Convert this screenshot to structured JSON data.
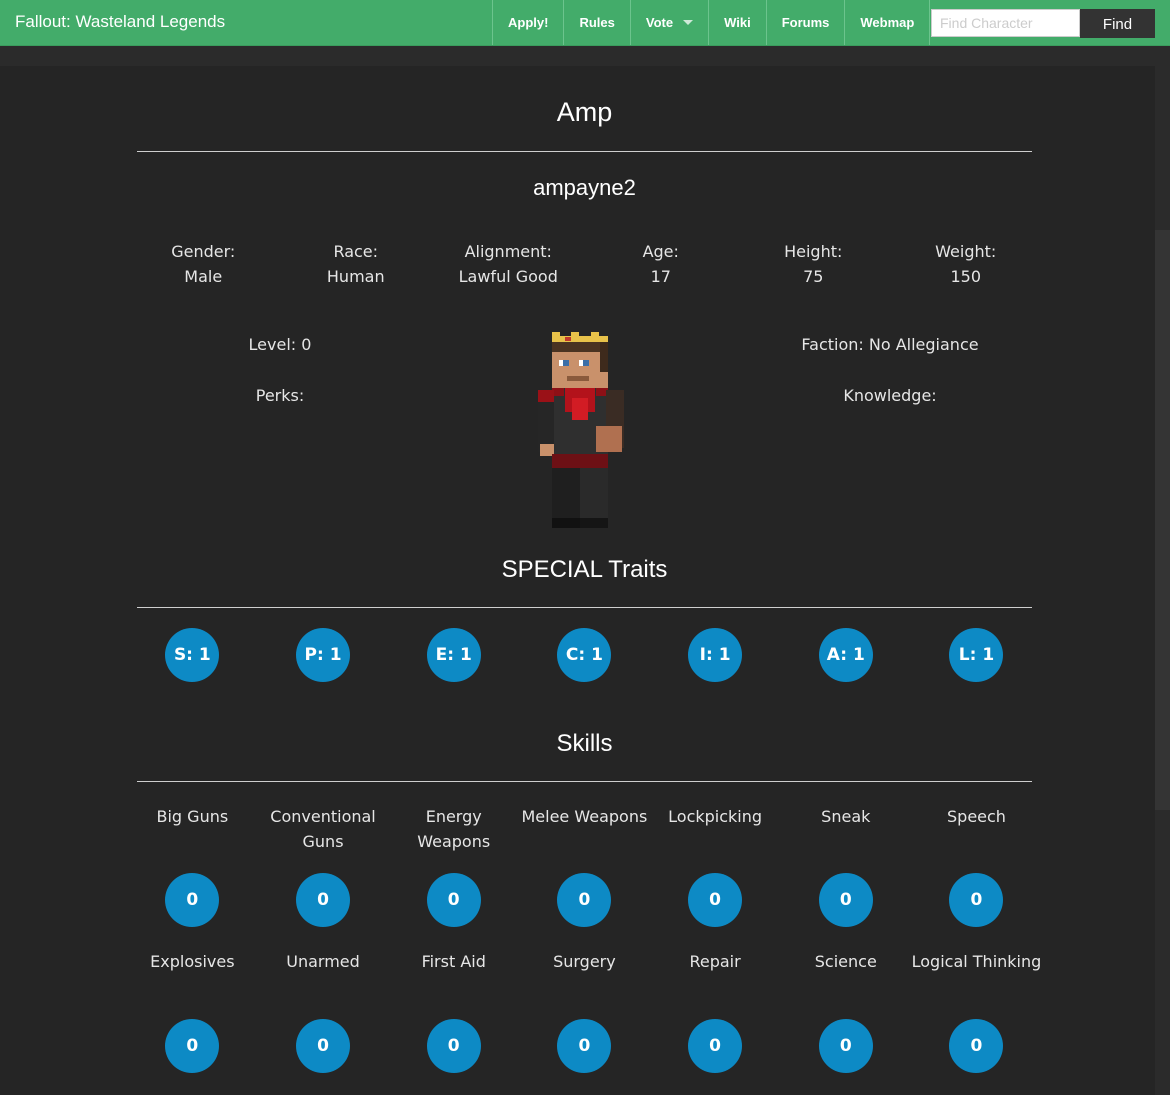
{
  "navbar": {
    "brand": "Fallout: Wasteland Legends",
    "items": [
      "Apply!",
      "Rules",
      "Vote",
      "Wiki",
      "Forums",
      "Webmap"
    ],
    "search_placeholder": "Find Character",
    "find_label": "Find"
  },
  "character": {
    "name": "Amp",
    "username": "ampayne2",
    "info": [
      {
        "label": "Gender:",
        "value": "Male"
      },
      {
        "label": "Race:",
        "value": "Human"
      },
      {
        "label": "Alignment:",
        "value": "Lawful Good"
      },
      {
        "label": "Age:",
        "value": "17"
      },
      {
        "label": "Height:",
        "value": "75"
      },
      {
        "label": "Weight:",
        "value": "150"
      }
    ],
    "level": "Level: 0",
    "perks": "Perks:",
    "faction": "Faction: No Allegiance",
    "knowledge": "Knowledge:"
  },
  "special": {
    "title": "SPECIAL Traits",
    "traits": [
      "S: 1",
      "P: 1",
      "E: 1",
      "C: 1",
      "I: 1",
      "A: 1",
      "L: 1"
    ]
  },
  "skills": {
    "title": "Skills",
    "row1": [
      {
        "name": "Big Guns",
        "value": "0"
      },
      {
        "name": "Conventional Guns",
        "value": "0"
      },
      {
        "name": "Energy Weapons",
        "value": "0"
      },
      {
        "name": "Melee Weapons",
        "value": "0"
      },
      {
        "name": "Lockpicking",
        "value": "0"
      },
      {
        "name": "Sneak",
        "value": "0"
      },
      {
        "name": "Speech",
        "value": "0"
      }
    ],
    "row2": [
      {
        "name": "Explosives",
        "value": "0"
      },
      {
        "name": "Unarmed",
        "value": "0"
      },
      {
        "name": "First Aid",
        "value": "0"
      },
      {
        "name": "Surgery",
        "value": "0"
      },
      {
        "name": "Repair",
        "value": "0"
      },
      {
        "name": "Science",
        "value": "0"
      },
      {
        "name": "Logical Thinking",
        "value": "0"
      }
    ]
  },
  "colors": {
    "navbar": "#43ac6a",
    "badge": "#0d8ac5",
    "background": "#252525"
  }
}
